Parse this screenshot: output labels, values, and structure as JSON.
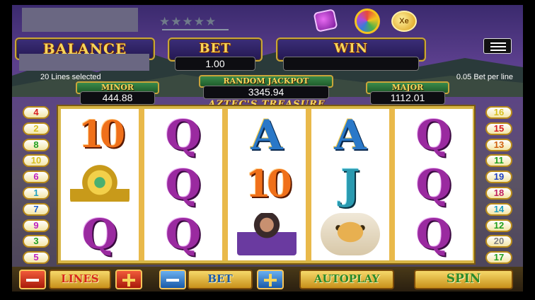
{
  "topbar": {
    "stars": "★★★★★",
    "coins_icon_label": "Xe"
  },
  "header": {
    "balance_title": "BALANCE",
    "bet_title": "BET",
    "bet_value": "1.00",
    "win_title": "WIN",
    "win_value": ""
  },
  "info": {
    "lines_selected": "20 Lines selected",
    "bet_per_line": "0.05 Bet per line"
  },
  "jackpots": {
    "minor_label": "MINOR",
    "minor_value": "444.88",
    "random_label": "RANDOM JACKPOT",
    "random_value": "3345.94",
    "major_label": "MAJOR",
    "major_value": "1112.01"
  },
  "game_title": "AZTEC'S TREASURE",
  "reels": [
    [
      "10",
      "amulet",
      "Q"
    ],
    [
      "Q",
      "Q",
      "Q"
    ],
    [
      "A",
      "10",
      "princess"
    ],
    [
      "A",
      "J",
      "jaguar"
    ],
    [
      "Q",
      "Q",
      "Q"
    ]
  ],
  "line_markers_left": [
    {
      "n": "4",
      "color": "#d82020"
    },
    {
      "n": "2",
      "color": "#d8c020"
    },
    {
      "n": "8",
      "color": "#20a020"
    },
    {
      "n": "10",
      "color": "#d8c020"
    },
    {
      "n": "6",
      "color": "#c020c0"
    },
    {
      "n": "1",
      "color": "#20a0c0"
    },
    {
      "n": "7",
      "color": "#2060d0"
    },
    {
      "n": "9",
      "color": "#c020c0"
    },
    {
      "n": "3",
      "color": "#20a020"
    },
    {
      "n": "5",
      "color": "#c020c0"
    }
  ],
  "line_markers_right": [
    {
      "n": "16",
      "color": "#d8c020"
    },
    {
      "n": "15",
      "color": "#d82020"
    },
    {
      "n": "13",
      "color": "#d06010"
    },
    {
      "n": "11",
      "color": "#20a020"
    },
    {
      "n": "19",
      "color": "#2040c0"
    },
    {
      "n": "18",
      "color": "#c02060"
    },
    {
      "n": "14",
      "color": "#20a0c0"
    },
    {
      "n": "12",
      "color": "#20a020"
    },
    {
      "n": "20",
      "color": "#808080"
    },
    {
      "n": "17",
      "color": "#20a020"
    }
  ],
  "controls": {
    "lines_label": "LINES",
    "bet_label": "BET",
    "autoplay_label": "AUTOPLAY",
    "spin_label": "SPIN"
  }
}
